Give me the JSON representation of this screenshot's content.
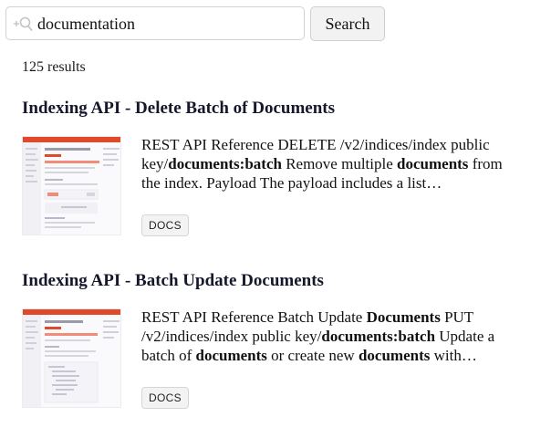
{
  "search": {
    "value": "documentation",
    "placeholder": "",
    "button_label": "Search",
    "icon": "search-icon"
  },
  "results_count": "125 results",
  "results": [
    {
      "title": "Indexing API - Delete Batch of Documents",
      "snippet": [
        {
          "text": "REST API Reference DELETE /v2/indices/index public key/",
          "bold": false
        },
        {
          "text": "documents:batch",
          "bold": true
        },
        {
          "text": " Remove multiple ",
          "bold": false
        },
        {
          "text": "documents",
          "bold": true
        },
        {
          "text": " from the index. Payload The payload includes a list…",
          "bold": false
        }
      ],
      "tag": "DOCS",
      "thumbnail": "delete-batch-page-preview"
    },
    {
      "title": "Indexing API - Batch Update Documents",
      "snippet": [
        {
          "text": "REST API Reference Batch Update ",
          "bold": false
        },
        {
          "text": "Documents",
          "bold": true
        },
        {
          "text": " PUT /v2/indices/index public key/",
          "bold": false
        },
        {
          "text": "documents:batch",
          "bold": true
        },
        {
          "text": " Update a batch of ",
          "bold": false
        },
        {
          "text": "documents",
          "bold": true
        },
        {
          "text": " or create new ",
          "bold": false
        },
        {
          "text": "documents",
          "bold": true
        },
        {
          "text": " with…",
          "bold": false
        }
      ],
      "tag": "DOCS",
      "thumbnail": "batch-update-page-preview"
    }
  ],
  "colors": {
    "title": "#15172b",
    "accent": "#e0492a",
    "tag_bg": "#f3f3f3",
    "border": "#d2d2d2"
  }
}
